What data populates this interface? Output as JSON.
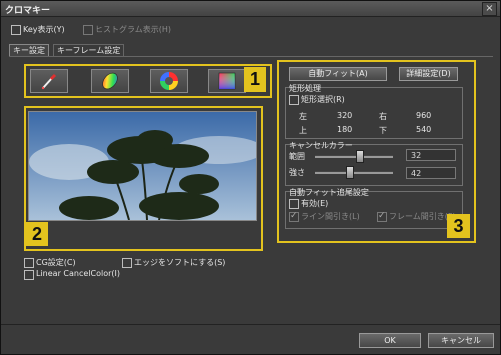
{
  "window": {
    "title": "クロマキー",
    "close_glyph": "×"
  },
  "top_options": {
    "key_display": {
      "label": "Key表示(Y)",
      "checked": false
    },
    "histogram_display": {
      "label": "ヒストグラム表示(H)",
      "checked": false,
      "enabled": false
    }
  },
  "tabs": [
    {
      "label": "キー設定",
      "active": true
    },
    {
      "label": "キーフレーム設定",
      "active": false
    }
  ],
  "tools": [
    "eyedropper-icon",
    "hue-ellipse-icon",
    "color-wheel-icon",
    "color-square-icon"
  ],
  "badges": {
    "one": "1",
    "two": "2",
    "three": "3"
  },
  "options": {
    "cg_setting": {
      "label": "CG設定(C)",
      "checked": false
    },
    "soft_edge": {
      "label": "エッジをソフトにする(S)",
      "checked": false
    },
    "linear_cancel": {
      "label": "Linear CancelColor(I)",
      "checked": false
    }
  },
  "right": {
    "auto_fit_button": "自動フィット(A)",
    "detail_button": "詳細設定(D)",
    "rect": {
      "title": "矩形処理",
      "select": {
        "label": "矩形選択(R)",
        "checked": false
      },
      "left_label": "左",
      "left_value": "320",
      "right_label": "右",
      "right_value": "960",
      "top_label": "上",
      "top_value": "180",
      "bottom_label": "下",
      "bottom_value": "540"
    },
    "cancel": {
      "title": "キャンセルカラー",
      "range_label": "範囲",
      "range_value": "32",
      "strength_label": "強さ",
      "strength_value": "42"
    },
    "autofit_track": {
      "title": "自動フィット追尾設定",
      "enable": {
        "label": "有効(E)",
        "checked": false
      },
      "line_thin": {
        "label": "ライン間引き(L)",
        "checked": true,
        "enabled": false
      },
      "frame_thin": {
        "label": "フレーム間引き(F)",
        "checked": true,
        "enabled": false
      }
    }
  },
  "footer": {
    "ok": "OK",
    "cancel": "キャンセル"
  }
}
